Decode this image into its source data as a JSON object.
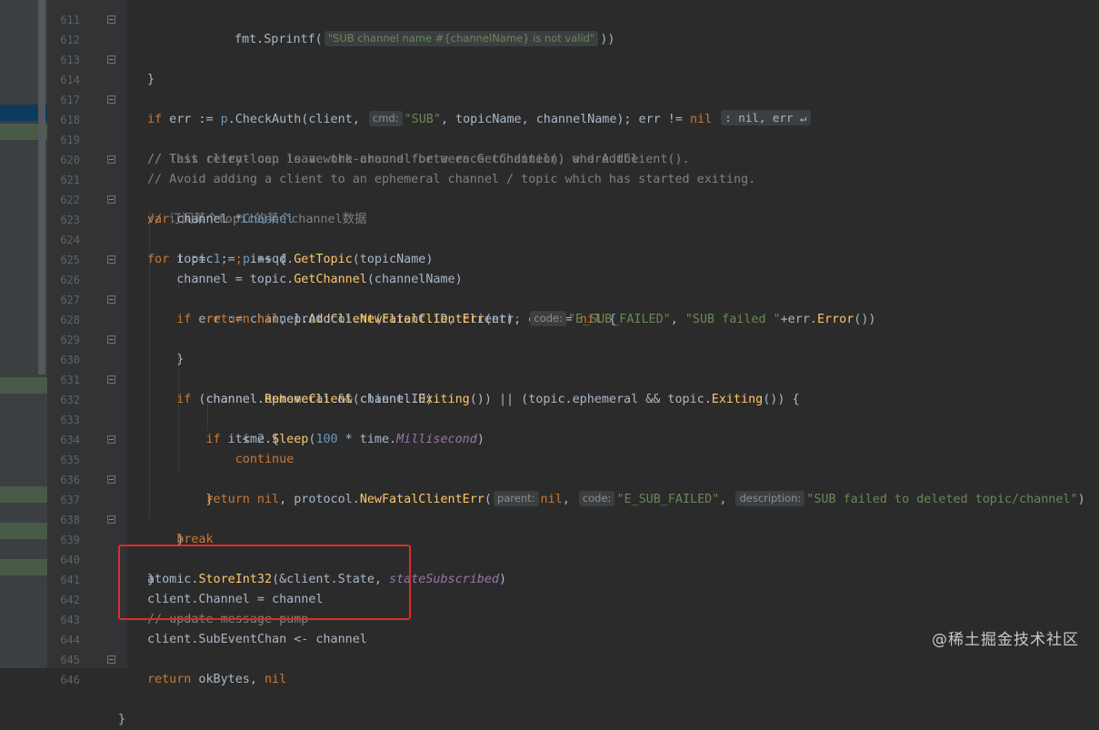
{
  "editor": {
    "lines": [
      {
        "num": "611",
        "text": "        fmt.Sprintf(\"SUB channel name #{channelName} is not valid\"))"
      },
      {
        "num": "612",
        "text": "}"
      },
      {
        "num": "613",
        "text": ""
      },
      {
        "num": "614",
        "text": "if err := p.CheckAuth(client, cmd: \"SUB\", topicName, channelName); err != nil : nil, err ↵"
      },
      {
        "num": "617",
        "text": ""
      },
      {
        "num": "618",
        "text": "// This retry-loop is a work-around for a race condition, where the"
      },
      {
        "num": "619",
        "text": "// last client can leave the channel between GetChannel() and AddClient()."
      },
      {
        "num": "620",
        "text": "// Avoid adding a client to an ephemeral channel / topic which has started exiting."
      },
      {
        "num": "621",
        "text": "// 订阅某个topic的某个channel数据"
      },
      {
        "num": "622",
        "text": "var channel *Channel"
      },
      {
        "num": "623",
        "text": "for i := 1; ; i++ {"
      },
      {
        "num": "624",
        "text": "    topic := p.nsqd.GetTopic(topicName)"
      },
      {
        "num": "625",
        "text": "    channel = topic.GetChannel(channelName)"
      },
      {
        "num": "626",
        "text": "    if err := channel.AddClient(client.ID, client); err != nil {"
      },
      {
        "num": "627",
        "text": "        return nil, protocol.NewFatalClientErr(err, code: \"E_SUB_FAILED\", \"SUB failed \"+err.Error())"
      },
      {
        "num": "628",
        "text": "    }"
      },
      {
        "num": "629",
        "text": ""
      },
      {
        "num": "630",
        "text": "    if (channel.ephemeral && channel.Exiting()) || (topic.ephemeral && topic.Exiting()) {"
      },
      {
        "num": "631",
        "text": "        channel.RemoveClient(client.ID)"
      },
      {
        "num": "632",
        "text": "        if i < 2 {"
      },
      {
        "num": "633",
        "text": "            time.Sleep(100 * time.Millisecond)"
      },
      {
        "num": "634",
        "text": "            continue"
      },
      {
        "num": "635",
        "text": "        }"
      },
      {
        "num": "636",
        "text": "        return nil, protocol.NewFatalClientErr( parent: nil, code: \"E_SUB_FAILED\", description: \"SUB failed to deleted topic/channel\")"
      },
      {
        "num": "637",
        "text": "    }"
      },
      {
        "num": "638",
        "text": "    break"
      },
      {
        "num": "639",
        "text": "}"
      },
      {
        "num": "640",
        "text": "atomic.StoreInt32(&client.State, stateSubscribed)"
      },
      {
        "num": "641",
        "text": "client.Channel = channel"
      },
      {
        "num": "642",
        "text": "// update message pump"
      },
      {
        "num": "643",
        "text": "client.SubEventChan <- channel"
      },
      {
        "num": "644",
        "text": ""
      },
      {
        "num": "645",
        "text": "return okBytes, nil"
      },
      {
        "num": "646",
        "text": "}"
      }
    ],
    "hints": {
      "cmd": "cmd:",
      "auth_result": ": nil, err ↵",
      "code": "code:",
      "parent": "parent:",
      "description": "description:"
    },
    "tokens": {
      "sprintf": "fmt.Sprintf(",
      "sprintf_str": "\"SUB channel name #{channelName} is not valid\"",
      "sprintf_tail": "))",
      "sub": "\"SUB\"",
      "e_sub_failed": "\"E_SUB_FAILED\"",
      "sub_failed": "\"SUB failed \"",
      "sub_failed_deleted": "\"SUB failed to deleted topic/channel\"",
      "comment_618": "// This retry-loop is a work-around for a race condition, where the",
      "comment_619": "// last client can leave the channel between GetChannel() and AddClient().",
      "comment_620": "// Avoid adding a client to an ephemeral channel / topic which has started exiting.",
      "comment_621": "// 订阅某个topic的某个channel数据",
      "comment_642": "// update message pump"
    }
  },
  "annotation": {
    "color": "#e02b2b"
  },
  "watermark": "@稀土掘金技术社区",
  "colors": {
    "background": "#2b2b2b",
    "keyword": "#cc7832",
    "function": "#ffc66d",
    "string": "#6a8759",
    "comment": "#808080",
    "number": "#6897bb",
    "field_italic": "#9876aa"
  }
}
